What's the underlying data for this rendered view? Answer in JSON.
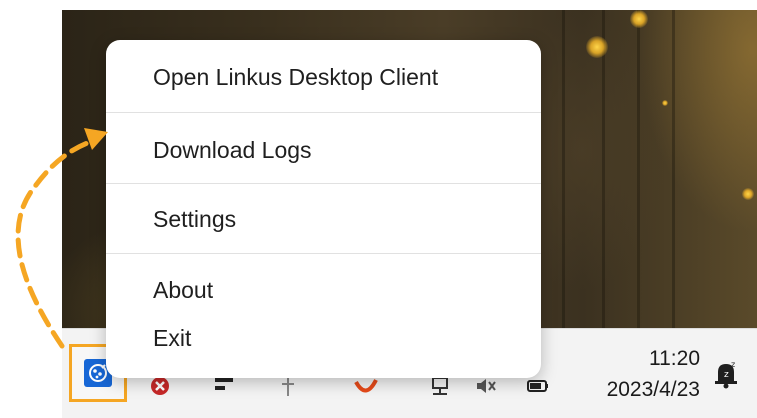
{
  "context_menu": {
    "items": [
      {
        "label": "Open Linkus Desktop Client"
      },
      {
        "label": "Download Logs"
      },
      {
        "label": "Settings"
      },
      {
        "label": "About"
      },
      {
        "label": "Exit"
      }
    ]
  },
  "taskbar": {
    "time": "11:20",
    "date": "2023/4/23",
    "tray_app_icon": "linkus-app-icon",
    "notification_icon": "bell-snooze-icon"
  },
  "colors": {
    "highlight": "#f5a623",
    "tray_app_bg": "#1767d6",
    "menu_bg": "#ffffff",
    "taskbar_bg": "#f3f3f3"
  }
}
